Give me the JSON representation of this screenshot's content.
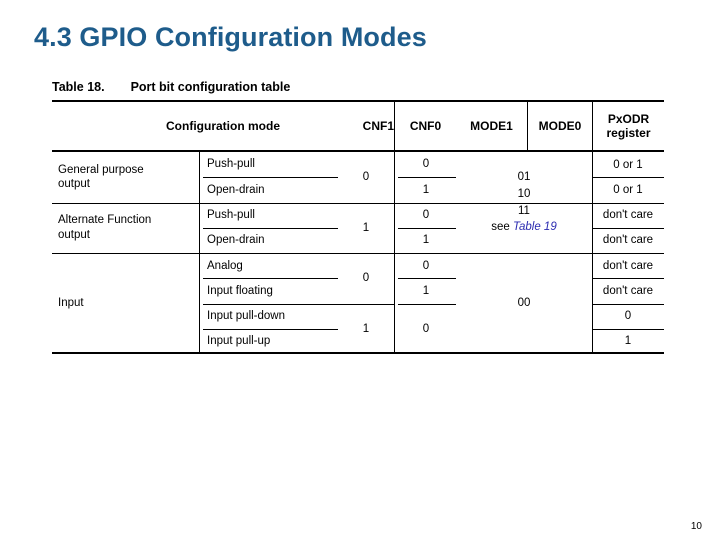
{
  "slide": {
    "title": "4.3 GPIO Configuration Modes",
    "title_color": "#1e5c8b",
    "page_number": "10"
  },
  "table": {
    "caption_label": "Table 18.",
    "caption_title": "Port bit configuration table",
    "headers": {
      "configuration_mode": "Configuration mode",
      "cnf1": "CNF1",
      "cnf0": "CNF0",
      "mode1": "MODE1",
      "mode0": "MODE0",
      "pxodr_line1": "PxODR",
      "pxodr_line2": "register"
    },
    "groups": [
      {
        "name": "General purpose output",
        "name_line1": "General purpose",
        "name_line2": "output",
        "cnf1": "0",
        "rows": [
          {
            "sub_mode": "Push-pull",
            "cnf0": "0",
            "pxodr": "0 or 1"
          },
          {
            "sub_mode": "Open-drain",
            "cnf0": "1",
            "pxodr": "0 or 1"
          }
        ]
      },
      {
        "name": "Alternate Function output",
        "name_line1": "Alternate Function",
        "name_line2": "output",
        "cnf1": "1",
        "rows": [
          {
            "sub_mode": "Push-pull",
            "cnf0": "0",
            "pxodr": "don't care"
          },
          {
            "sub_mode": "Open-drain",
            "cnf0": "1",
            "pxodr": "don't care"
          }
        ]
      },
      {
        "name": "Input",
        "name_line1": "Input",
        "name_line2": "",
        "cnf1_upper": "0",
        "cnf1_lower": "1",
        "rows": [
          {
            "sub_mode": "Analog",
            "cnf0": "0",
            "pxodr": "don't care"
          },
          {
            "sub_mode": "Input floating",
            "cnf0": "1",
            "pxodr": "don't care"
          },
          {
            "sub_mode": "Input pull-down",
            "cnf0": "0",
            "pxodr": "0"
          },
          {
            "sub_mode": "Input pull-up",
            "cnf0": "",
            "pxodr": "1"
          }
        ]
      }
    ],
    "mode_output_block": {
      "line1": "01",
      "line2": "10",
      "line3": "11",
      "see_prefix": "see",
      "see_link": "Table 19"
    },
    "mode_input_block": {
      "value": "00"
    }
  }
}
